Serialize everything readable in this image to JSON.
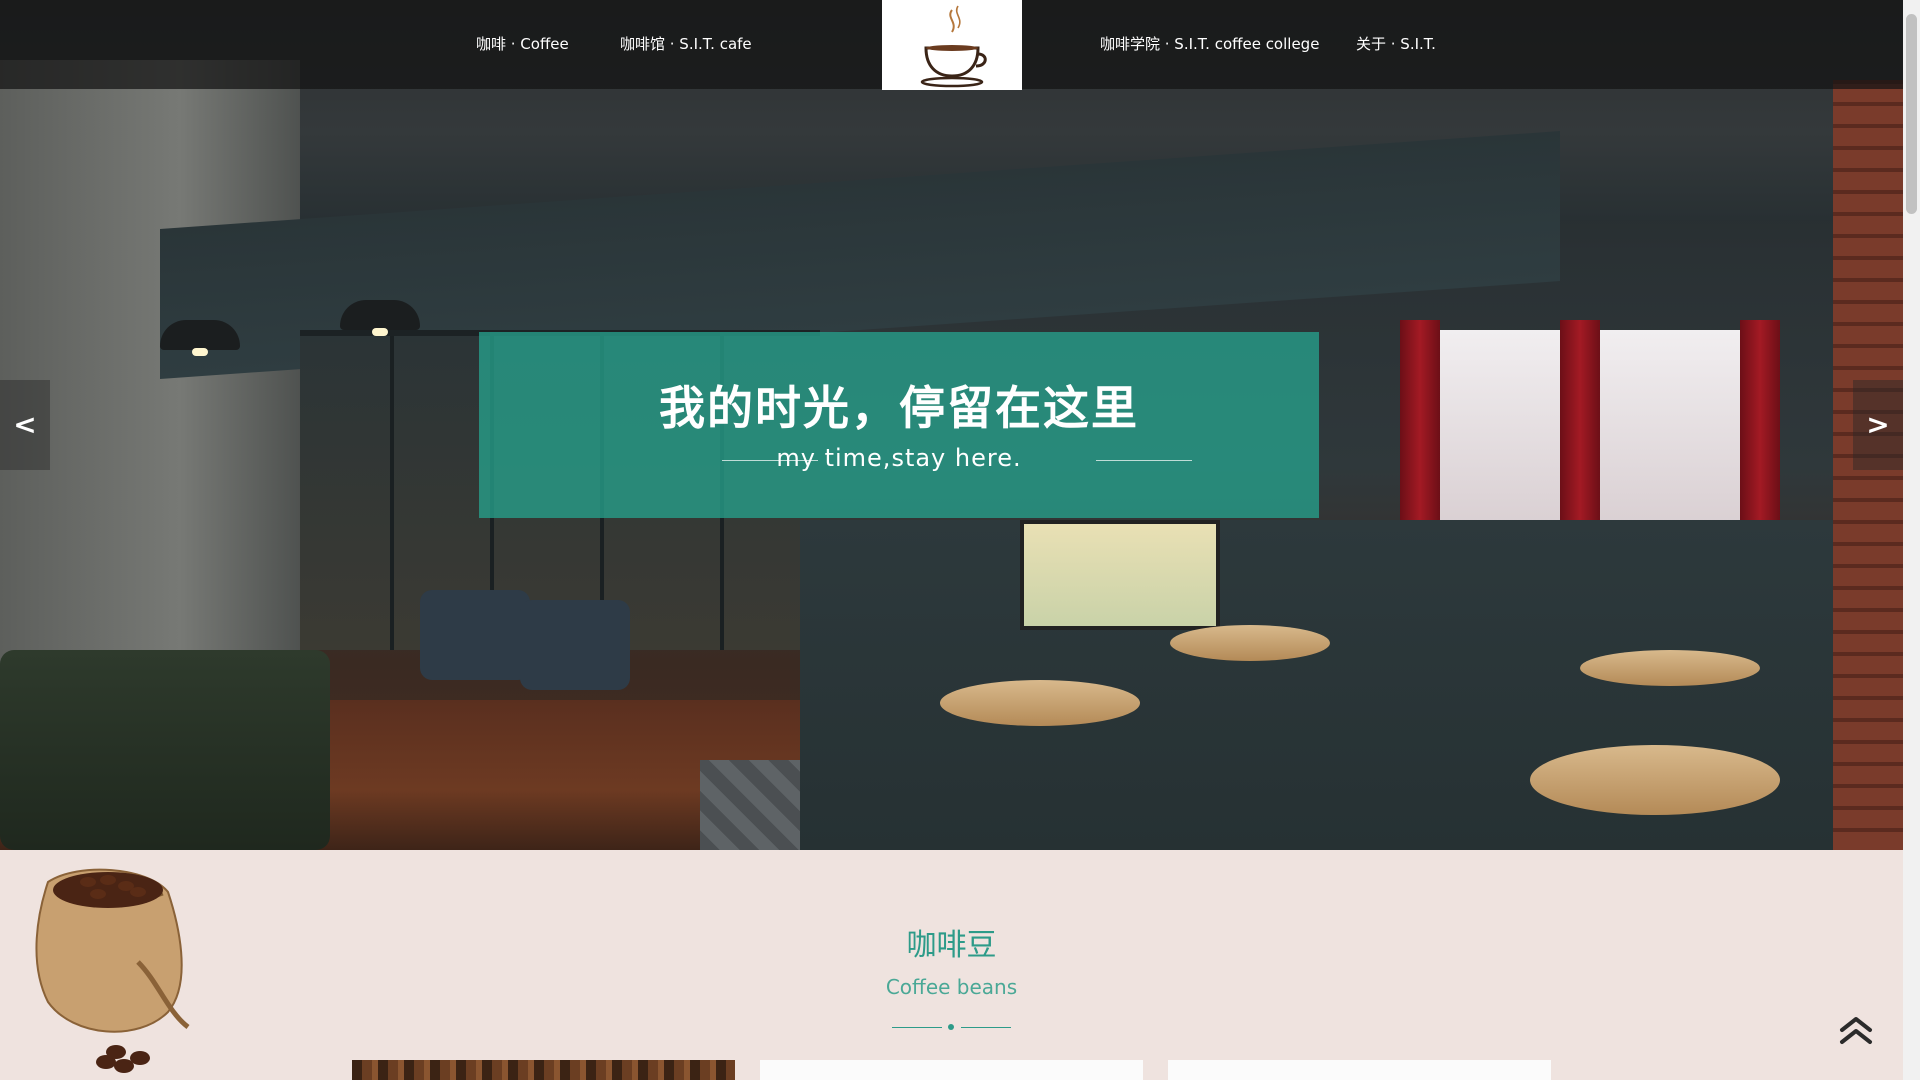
{
  "nav": {
    "items": [
      {
        "label": "咖啡 · Coffee"
      },
      {
        "label": "咖啡馆 · S.I.T. cafe"
      },
      {
        "label": "咖啡学院 · S.I.T. coffee college"
      },
      {
        "label": "关于 · S.I.T."
      }
    ],
    "logo_icon": "coffee-cup-logo"
  },
  "hero": {
    "title": "我的时光，停留在这里",
    "subtitle": "my time,stay here.",
    "prev_label": "<",
    "next_label": ">",
    "accent_color": "#26a08c"
  },
  "section": {
    "title": "咖啡豆",
    "subtitle": "Coffee beans",
    "accent_color": "#2d9b89"
  },
  "colors": {
    "background": "#efe3df",
    "nav_background": "#141414"
  },
  "icons": {
    "back_to_top": "double-chevron-up-icon",
    "beans": "coffee-bean-sack-icon"
  }
}
